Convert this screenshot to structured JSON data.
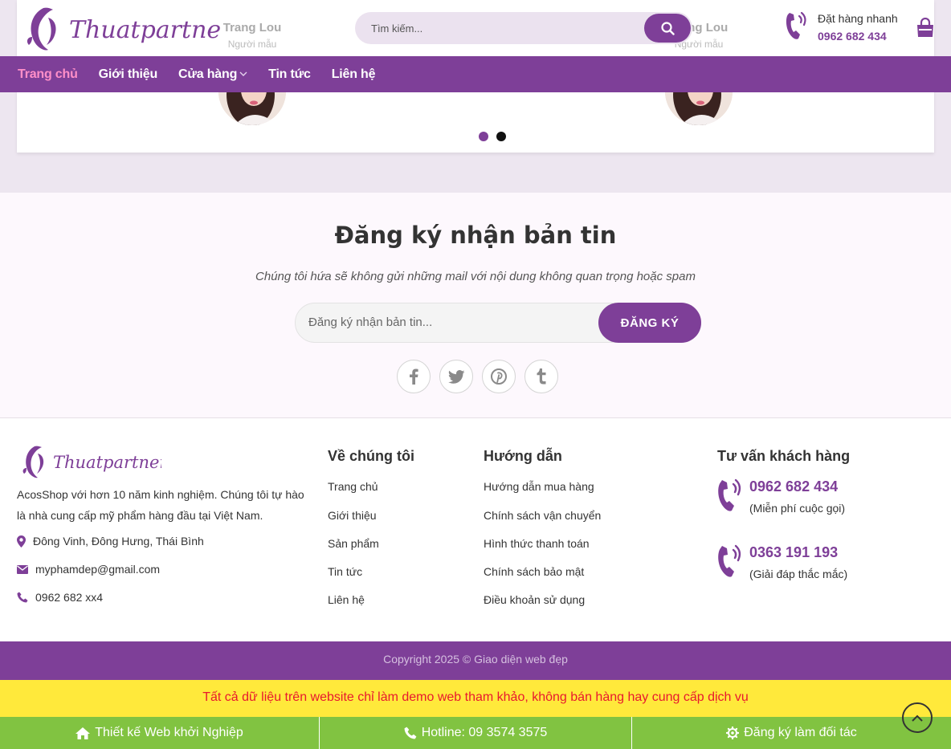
{
  "brand": {
    "logo_text": "Thuatpartner",
    "accent": "#7e3f98",
    "highlight": "#ff8fc8"
  },
  "testimonials": {
    "items": [
      {
        "name": "Trang Lou",
        "role": "Người mẫu"
      },
      {
        "name": "Trang Lou",
        "role": "Người mẫu"
      }
    ],
    "dots": 2,
    "active_dot": 0
  },
  "header": {
    "search_placeholder": "Tìm kiếm...",
    "hotline_label": "Đặt hàng nhanh",
    "hotline_number": "0962 682 434"
  },
  "nav": {
    "items": [
      {
        "label": "Trang chủ",
        "active": true
      },
      {
        "label": "Giới thiệu"
      },
      {
        "label": "Cửa hàng",
        "dropdown": true
      },
      {
        "label": "Tin tức"
      },
      {
        "label": "Liên hệ"
      }
    ]
  },
  "newsletter": {
    "title": "Đăng ký nhận bản tin",
    "subtitle": "Chúng tôi hứa sẽ không gửi những mail với nội dung không quan trọng hoặc spam",
    "placeholder": "Đăng ký nhận bản tin...",
    "button": "ĐĂNG KÝ",
    "socials": [
      "facebook-icon",
      "twitter-icon",
      "pinterest-icon",
      "tumblr-icon"
    ]
  },
  "footer": {
    "about": "AcosShop với hơn 10 năm kinh nghiệm. Chúng tôi tự hào là nhà cung cấp mỹ phẩm hàng đầu tại Việt Nam.",
    "address": "Đông Vinh, Đông Hưng, Thái Bình",
    "email": "myphamdep@gmail.com",
    "phone": "0962 682 xx4",
    "col_about": {
      "title": "Về chúng tôi",
      "links": [
        "Trang chủ",
        "Giới thiệu",
        "Sản phẩm",
        "Tin tức",
        "Liên hệ"
      ]
    },
    "col_guide": {
      "title": "Hướng dẫn",
      "links": [
        "Hướng dẫn mua hàng",
        "Chính sách vận chuyển",
        "Hình thức thanh toán",
        "Chính sách bảo mật",
        "Điều khoản sử dụng"
      ]
    },
    "col_support": {
      "title": "Tư vấn khách hàng",
      "phones": [
        {
          "number": "0962 682 434",
          "note": "(Miễn phí cuộc gọi)"
        },
        {
          "number": "0363 191 193",
          "note": "(Giải đáp thắc mắc)"
        }
      ]
    }
  },
  "copyright": "Copyright 2025 © Giao diện web đẹp",
  "notice": "Tất cả dữ liệu trên website chỉ làm demo web tham khảo, không bán hàng hay cung cấp dịch vụ",
  "bottom_bar": {
    "items": [
      {
        "label": "Thiết kế Web khởi Nghiệp",
        "icon": "home-icon"
      },
      {
        "label": "Hotline: 09 3574 3575",
        "icon": "phone-icon"
      },
      {
        "label": "Đăng ký làm đối tác",
        "icon": "gear-icon"
      }
    ]
  }
}
